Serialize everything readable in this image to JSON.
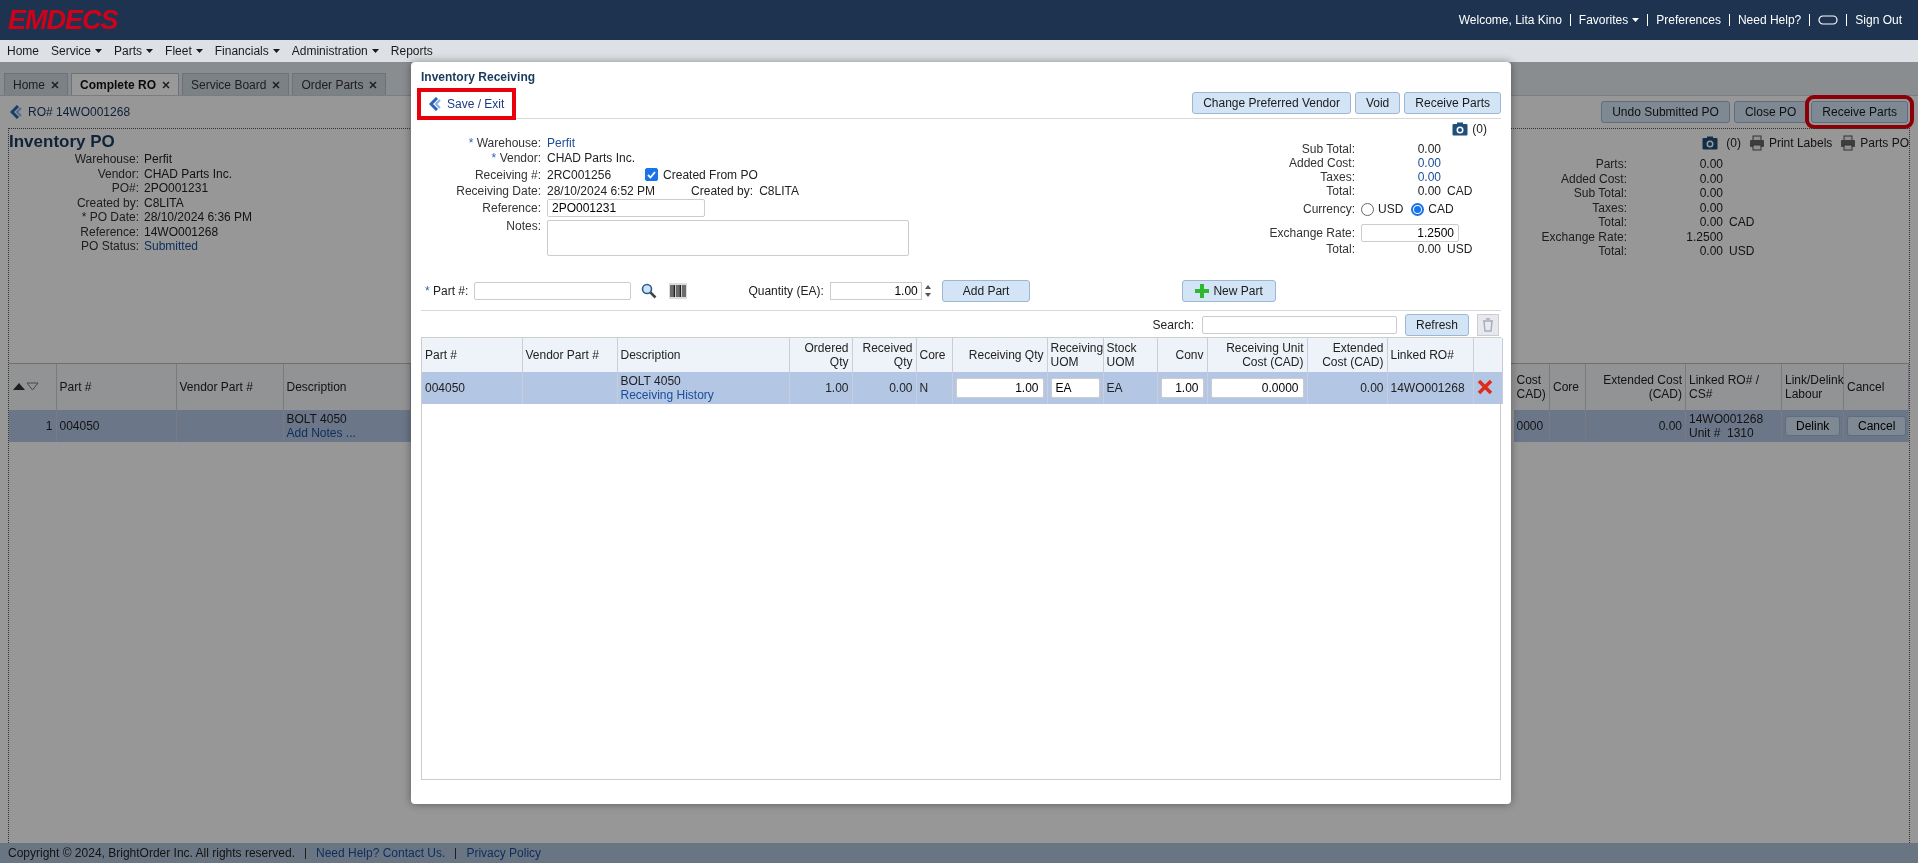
{
  "header": {
    "logo": "EMDECS",
    "welcome": "Welcome, Lita Kino",
    "links": [
      {
        "label": "Favorites",
        "dropdown": true
      },
      {
        "label": "Preferences",
        "dropdown": false
      },
      {
        "label": "Need Help?",
        "dropdown": false
      }
    ],
    "sign_out": "Sign Out"
  },
  "menu": [
    {
      "label": "Home",
      "dropdown": false
    },
    {
      "label": "Service",
      "dropdown": true
    },
    {
      "label": "Parts",
      "dropdown": true
    },
    {
      "label": "Fleet",
      "dropdown": true
    },
    {
      "label": "Financials",
      "dropdown": true
    },
    {
      "label": "Administration",
      "dropdown": true
    },
    {
      "label": "Reports",
      "dropdown": false
    }
  ],
  "tabs": [
    {
      "label": "Home",
      "selected": false
    },
    {
      "label": "Complete RO",
      "selected": true
    },
    {
      "label": "Service Board",
      "selected": false
    },
    {
      "label": "Order Parts",
      "selected": false
    }
  ],
  "ro_link": "RO# 14WO001268",
  "po_actions": [
    {
      "label": "Undo Submitted PO",
      "highlighted": false
    },
    {
      "label": "Close PO",
      "highlighted": false
    },
    {
      "label": "Receive Parts",
      "highlighted": true
    }
  ],
  "po": {
    "title": "Inventory PO",
    "fields": [
      {
        "label": "Warehouse:",
        "value": "Perfit",
        "kind": "text"
      },
      {
        "label": "Vendor:",
        "value": "CHAD Parts Inc.",
        "kind": "text"
      },
      {
        "label": "PO#:",
        "value": "2PO001231",
        "kind": "text"
      },
      {
        "label": "Created by:",
        "value": "C8LITA",
        "kind": "text"
      },
      {
        "label": "* PO Date:",
        "value": "28/10/2024 6:36 PM",
        "kind": "text"
      },
      {
        "label": "Reference:",
        "value": "14WO001268",
        "kind": "text"
      },
      {
        "label": "PO Status:",
        "value": "Submitted",
        "kind": "link"
      }
    ]
  },
  "po_tools": {
    "photo_count": "(0)",
    "print_labels": "Print Labels",
    "parts_po": "Parts PO"
  },
  "po_totals": [
    {
      "label": "Parts:",
      "value": "0.00"
    },
    {
      "label": "Added Cost:",
      "value": "0.00"
    },
    {
      "label": "Sub Total:",
      "value": "0.00"
    },
    {
      "label": "Taxes:",
      "value": "0.00"
    },
    {
      "label": "Total:",
      "value": "0.00",
      "unit": "CAD"
    },
    {
      "label": "Exchange Rate:",
      "value": "1.2500"
    },
    {
      "label": "Total:",
      "value": "0.00",
      "unit": "USD"
    }
  ],
  "po_table": {
    "left_columns": [
      "Part #",
      "Vendor Part #",
      "Description"
    ],
    "right_columns": [
      "Cost\nCAD)",
      "Core",
      "Extended Cost (CAD)",
      "Linked RO# / CS#",
      "Link/Delink Labour",
      "Cancel"
    ],
    "rows": [
      {
        "selected": true,
        "line": "1",
        "part_no": "004050",
        "description": "BOLT 4050",
        "notes_link": "Add Notes ...",
        "cost": "0000",
        "extended_cost": "0.00",
        "linked_ro": "14WO001268",
        "unit": "Unit #  1310",
        "delink": "Delink",
        "cancel": "Cancel"
      }
    ]
  },
  "modal": {
    "title": "Inventory Receiving",
    "save_exit": {
      "label": "Save / Exit",
      "highlighted": true
    },
    "actions": [
      "Change Preferred Vendor",
      "Void",
      "Receive Parts"
    ],
    "photo_count": "(0)",
    "form": {
      "mark": "*",
      "warehouse_label": "Warehouse:",
      "warehouse": "Perfit",
      "vendor_label": "Vendor:",
      "vendor": "CHAD Parts Inc.",
      "receiving_no_label": "Receiving #:",
      "receiving_no": "2RC001256",
      "created_from_po": {
        "label": "Created From PO",
        "checked": true
      },
      "date_label": "Receiving Date:",
      "date": "28/10/2024 6:52 PM",
      "created_by_label": "Created by:",
      "created_by": "C8LITA",
      "reference_label": "Reference:",
      "reference": "2PO001231",
      "notes_label": "Notes:"
    },
    "totals": [
      {
        "label": "Sub Total:",
        "value": "0.00",
        "kind": "text"
      },
      {
        "label": "Added Cost:",
        "value": "0.00",
        "kind": "link"
      },
      {
        "label": "Taxes:",
        "value": "0.00",
        "kind": "link"
      },
      {
        "label": "Total:",
        "value": "0.00",
        "unit": "CAD",
        "kind": "text"
      }
    ],
    "currency": {
      "label": "Currency:",
      "options": [
        {
          "label": "USD",
          "selected": false
        },
        {
          "label": "CAD",
          "selected": true
        }
      ]
    },
    "exchange_rate": {
      "label": "Exchange Rate:",
      "value": "1.2500"
    },
    "total_usd": {
      "label": "Total:",
      "value": "0.00",
      "unit": "USD"
    },
    "part_entry": {
      "mark": "*",
      "label": "Part #:",
      "quantity_label": "Quantity (EA):",
      "quantity": "1.00",
      "add_button": "Add Part",
      "new_button": "New Part"
    },
    "search": {
      "label": "Search:",
      "refresh": "Refresh"
    },
    "table": {
      "columns": [
        "Part #",
        "Vendor Part #",
        "Description",
        "Ordered Qty",
        "Received Qty",
        "Core",
        "Receiving Qty",
        "Receiving UOM",
        "Stock UOM",
        "Conv",
        "Receiving Unit Cost (CAD)",
        "Extended Cost (CAD)",
        "Linked RO#"
      ],
      "rows": [
        {
          "selected": true,
          "part_no": "004050",
          "description": "BOLT 4050",
          "history_link": "Receiving History",
          "ordered_qty": "1.00",
          "received_qty": "0.00",
          "core": "N",
          "receiving_qty": "1.00",
          "receiving_uom": "EA",
          "stock_uom": "EA",
          "conv": "1.00",
          "unit_cost": "0.0000",
          "extended_cost": "0.00",
          "linked_ro": "14WO001268"
        }
      ]
    }
  },
  "footer": {
    "copyright": "Copyright © 2024, BrightOrder Inc. All rights reserved.",
    "links": [
      "Need Help? Contact Us.",
      "Privacy Policy"
    ]
  }
}
